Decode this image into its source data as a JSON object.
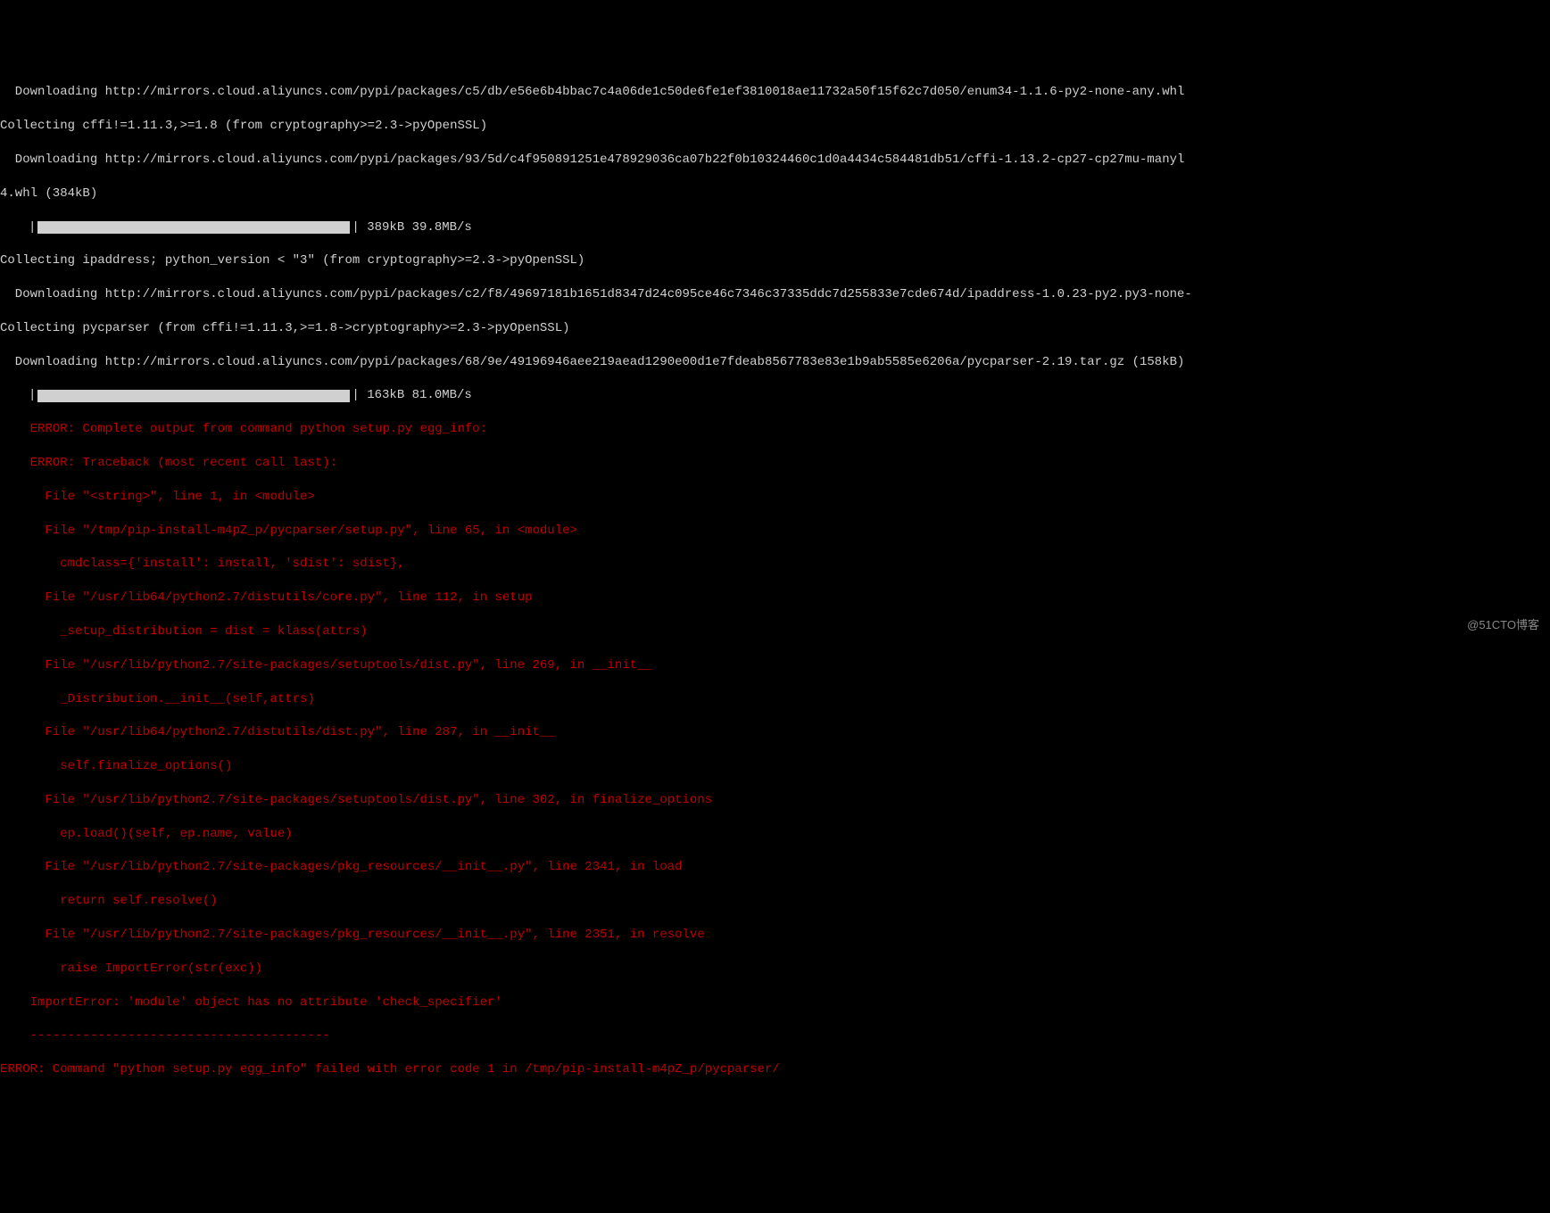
{
  "lines": {
    "l1": "  Downloading http://mirrors.cloud.aliyuncs.com/pypi/packages/c5/db/e56e6b4bbac7c4a06de1c50de6fe1ef3810018ae11732a50f15f62c7d050/enum34-1.1.6-py2-none-any.whl",
    "l2": "Collecting cffi!=1.11.3,>=1.8 (from cryptography>=2.3->pyOpenSSL)",
    "l3": "  Downloading http://mirrors.cloud.aliyuncs.com/pypi/packages/93/5d/c4f950891251e478929036ca07b22f0b10324460c1d0a4434c584481db51/cffi-1.13.2-cp27-cp27mu-manyl",
    "l4": "4.whl (384kB)",
    "pbar1_stats": " 389kB 39.8MB/s",
    "l5": "Collecting ipaddress; python_version < \"3\" (from cryptography>=2.3->pyOpenSSL)",
    "l6": "  Downloading http://mirrors.cloud.aliyuncs.com/pypi/packages/c2/f8/49697181b1651d8347d24c095ce46c7346c37335ddc7d255833e7cde674d/ipaddress-1.0.23-py2.py3-none-",
    "l7": "Collecting pycparser (from cffi!=1.11.3,>=1.8->cryptography>=2.3->pyOpenSSL)",
    "l8": "  Downloading http://mirrors.cloud.aliyuncs.com/pypi/packages/68/9e/49196946aee219aead1290e00d1e7fdeab8567783e83e1b9ab5585e6206a/pycparser-2.19.tar.gz (158kB)",
    "pbar2_stats": " 163kB 81.0MB/s",
    "e1": "    ERROR: Complete output from command python setup.py egg_info:",
    "e2": "    ERROR: Traceback (most recent call last):",
    "e3": "      File \"<string>\", line 1, in <module>",
    "e4": "      File \"/tmp/pip-install-m4pZ_p/pycparser/setup.py\", line 65, in <module>",
    "e5": "        cmdclass={'install': install, 'sdist': sdist},",
    "e6": "      File \"/usr/lib64/python2.7/distutils/core.py\", line 112, in setup",
    "e7": "        _setup_distribution = dist = klass(attrs)",
    "e8": "      File \"/usr/lib/python2.7/site-packages/setuptools/dist.py\", line 269, in __init__",
    "e9": "        _Distribution.__init__(self,attrs)",
    "e10": "      File \"/usr/lib64/python2.7/distutils/dist.py\", line 287, in __init__",
    "e11": "        self.finalize_options()",
    "e12": "      File \"/usr/lib/python2.7/site-packages/setuptools/dist.py\", line 302, in finalize_options",
    "e13": "        ep.load()(self, ep.name, value)",
    "e14": "      File \"/usr/lib/python2.7/site-packages/pkg_resources/__init__.py\", line 2341, in load",
    "e15": "        return self.resolve()",
    "e16": "      File \"/usr/lib/python2.7/site-packages/pkg_resources/__init__.py\", line 2351, in resolve",
    "e17": "        raise ImportError(str(exc))",
    "e18": "    ImportError: 'module' object has no attribute 'check_specifier'",
    "dash": "    ----------------------------------------",
    "efinal": "ERROR: Command \"python setup.py egg_info\" failed with error code 1 in /tmp/pip-install-m4pZ_p/pycparser/"
  },
  "watermark": "@51CTO博客"
}
